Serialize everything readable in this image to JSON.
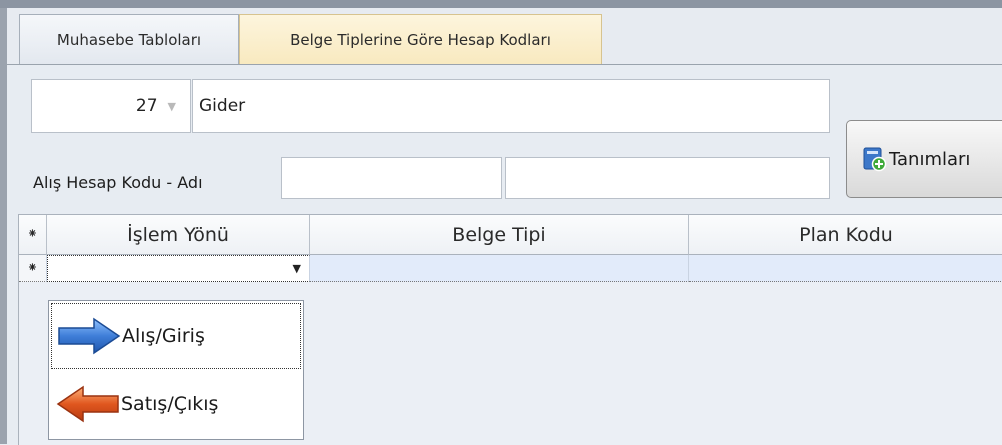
{
  "tabs": [
    {
      "label": "Muhasebe Tabloları",
      "active": false
    },
    {
      "label": "Belge Tiplerine Göre Hesap Kodları",
      "active": true
    }
  ],
  "form": {
    "code_value": "27",
    "name_value": "Gider",
    "alis_label": "Alış Hesap Kodu - Adı",
    "alis_code_value": "",
    "alis_name_value": ""
  },
  "button": {
    "label": "Tanımları",
    "icon": "add-document-icon"
  },
  "grid": {
    "indicator_symbol": "⁕",
    "columns": [
      "İşlem Yönü",
      "Belge Tipi",
      "Plan Kodu"
    ],
    "new_row": {
      "islem_yonu": "",
      "belge_tipi": "",
      "plan_kodu": ""
    }
  },
  "dropdown": {
    "options": [
      {
        "label": "Alış/Giriş",
        "icon": "arrow-right-icon"
      },
      {
        "label": "Satış/Çıkış",
        "icon": "arrow-left-icon"
      }
    ]
  },
  "colors": {
    "accent_blue": "#3f7ed8",
    "accent_orange": "#e0571f",
    "tab_active": "#f8e9bf"
  }
}
